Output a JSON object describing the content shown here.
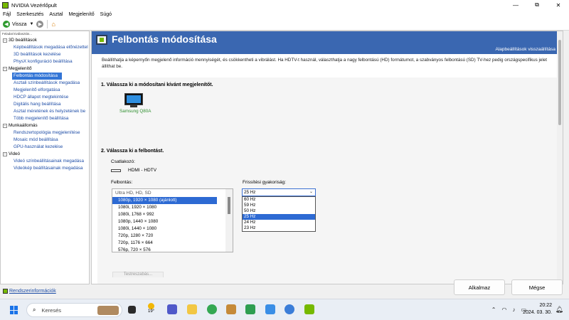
{
  "window": {
    "title": "NVIDIA Vezérlőpult",
    "minimize": "—",
    "restore": "⧉",
    "close": "✕"
  },
  "menu": [
    "Fájl",
    "Szerkesztés",
    "Asztal",
    "Megjelenítő",
    "Súgó"
  ],
  "toolbar": {
    "back_label": "Vissza"
  },
  "left": {
    "header": "Feladat kiválasztás...",
    "tree": [
      {
        "label": "3D beállítások",
        "items": [
          "Képbeállítások megadása előnézettel",
          "3D beállítások kezelése",
          "PhysX konfiguráció beállítása"
        ]
      },
      {
        "label": "Megjelenítő",
        "items": [
          "Felbontás módosítása",
          "Asztali színbeállítások megadása",
          "Megjelenítő elforgatása",
          "HDCP állapot megtekintése",
          "Digitális hang beállítása",
          "Asztal méretének és helyzetének be",
          "Több megjelenítő beállítása"
        ]
      },
      {
        "label": "Munkaállomás",
        "items": [
          "Rendszertopológia megjelenítése",
          "Mosaic mód beállítása",
          "GPU-használat kezelése"
        ]
      },
      {
        "label": "Videó",
        "items": [
          "Videó színbeállításainak megadása",
          "Videókép beállításainak megadása"
        ]
      }
    ],
    "selected": "Felbontás módosítása",
    "sysinfo": "Rendszerinformációk"
  },
  "main": {
    "title": "Felbontás módosítása",
    "restore_defaults": "Alapbeállítások visszaállítása",
    "description": "Beállíthatja a képernyőn megjelenő információ mennyiségét, és csökkentheti a vibrálást. Ha HDTV-t használ, választhatja a nagy felbontású (HD) formátumot, a szabványos felbontású (SD) TV-hez pedig országspecifikus jelet állíthat be.",
    "step1": "1. Válassza ki a módosítani kívánt megjelenítőt.",
    "monitor_name": "Samsung Q80A",
    "step2": "2. Válassza ki a felbontást.",
    "connector_label": "Csatlakozó:",
    "connector_value": "HDMI - HDTV",
    "resolution_label": "Felbontás:",
    "resolution_group": "Ultra HD, HD, SD",
    "resolutions": [
      "1080p, 1920 × 1080 (ajánlott)",
      "1080i, 1920 × 1080",
      "1080i, 1768 × 992",
      "1080p, 1440 × 1080",
      "1080i, 1440 × 1080",
      "720p, 1280 × 720",
      "720p, 1176 × 664",
      "576p, 720 × 576"
    ],
    "selected_resolution": "1080p, 1920 × 1080 (ajánlott)",
    "refresh_label": "Frissítési gyakoriság:",
    "refresh_current": "25 Hz",
    "refresh_options": [
      "60 Hz",
      "59 Hz",
      "50 Hz",
      "25 Hz",
      "24 Hz",
      "23 Hz"
    ],
    "customize": "Testreszabás..."
  },
  "buttons": {
    "apply": "Alkalmaz",
    "cancel": "Mégse"
  },
  "taskbar": {
    "search": "Keresés",
    "temp": "19°",
    "time": "20:22",
    "date": "2024. 03. 30."
  }
}
